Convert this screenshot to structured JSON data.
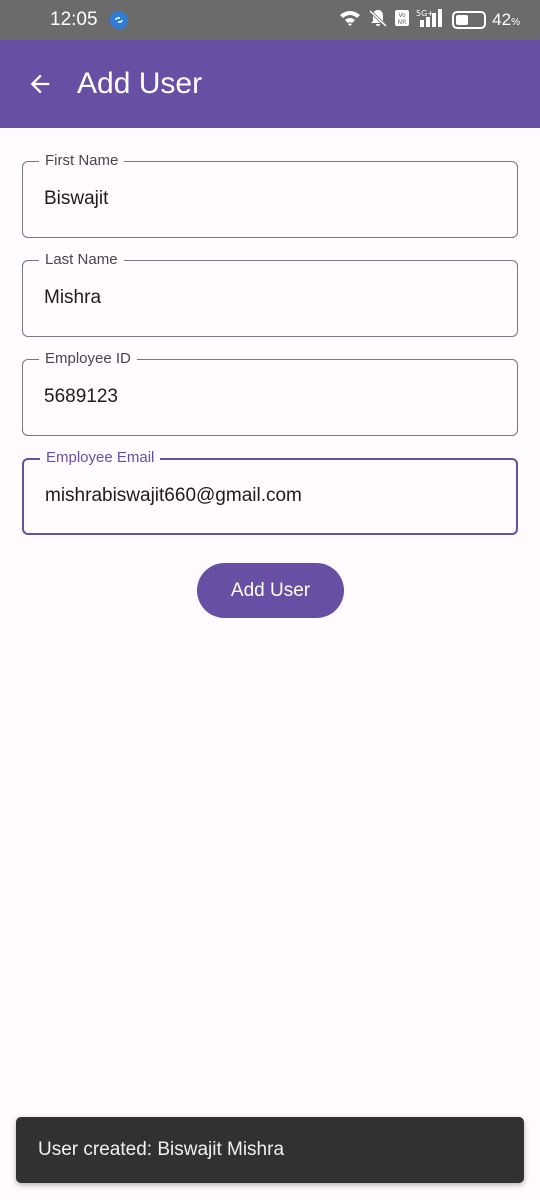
{
  "status_bar": {
    "time": "12:05",
    "battery_percent": "42",
    "battery_unit": "%"
  },
  "app_bar": {
    "title": "Add User",
    "back_icon": "arrow-back-icon"
  },
  "form": {
    "first_name": {
      "label": "First Name",
      "value": "Biswajit"
    },
    "last_name": {
      "label": "Last Name",
      "value": "Mishra"
    },
    "employee_id": {
      "label": "Employee ID",
      "value": "5689123"
    },
    "employee_email": {
      "label": "Employee Email",
      "value": "mishrabiswajit660@gmail.com"
    }
  },
  "submit_button": {
    "label": "Add User"
  },
  "snackbar": {
    "message": "User created: Biswajit Mishra"
  },
  "colors": {
    "primary": "#6750a4",
    "status_bar": "#6b6b6b",
    "background": "#fffbfe",
    "snackbar": "#313033"
  }
}
